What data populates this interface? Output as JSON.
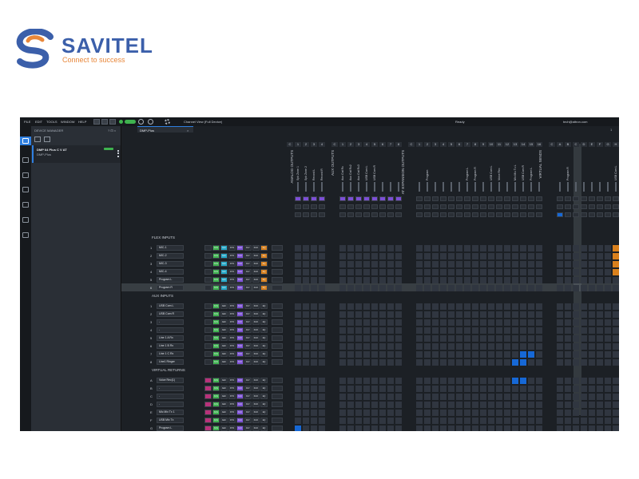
{
  "logo": {
    "word": "SAVITEL",
    "tagline": "Connect to success",
    "colors": {
      "primary": "#3b5faa",
      "accent": "#e8873a"
    }
  },
  "menubar": {
    "items": [
      "FILE",
      "EDIT",
      "TOOLS",
      "WINDOW",
      "HELP"
    ],
    "channel_view": "Channel View (Full Device)",
    "status": "Ready",
    "email": "tech@attron.com"
  },
  "device_manager": {
    "title": "DEVICE MANAGER",
    "controls": "? ⊡ ×",
    "device": {
      "name": "DMP 64 Plus C V AT",
      "sub": "DMP-Plus"
    }
  },
  "tab": {
    "label": "DMP-Plus",
    "close": "×",
    "number": "1"
  },
  "sections": {
    "flex": "FLEX INPUTS",
    "aux": "AUX INPUTS",
    "virtual": "VIRTUAL RETURNS"
  },
  "column_groups": {
    "analog": "ANALOG OUTPUTS",
    "aux": "AUX OUTPUTS",
    "expansion": "AT EXPANSION OUTPUTS",
    "vsends": "VIRTUAL SENDS"
  },
  "column_numbers": [
    "C",
    "1",
    "2",
    "3",
    "4",
    "C",
    "1",
    "2",
    "3",
    "4",
    "5",
    "6",
    "7",
    "8",
    "C",
    "1",
    "2",
    "3",
    "4",
    "5",
    "6",
    "7",
    "8",
    "9",
    "10",
    "11",
    "12",
    "13",
    "14",
    "15",
    "16",
    "C",
    "A",
    "B",
    "C",
    "D",
    "E",
    "F",
    "G",
    "H",
    "I",
    "J",
    "K"
  ],
  "column_labels": [
    "Spk Zone 1",
    "Spk Zone 2",
    "Record L",
    "Record R",
    "Aux Out Rx",
    "Aux Out Rx2",
    "Aux Out Rx3",
    "USB Com L",
    "USB Com R",
    "Program",
    "Program L",
    "Program R",
    "USB Com L",
    "Voice Rec",
    "Mic Mix Tx L",
    "USB Com R",
    "Program L",
    "Program R",
    "USB Com L"
  ],
  "flex_rows": [
    {
      "idx": "1",
      "name": "MIC-1"
    },
    {
      "idx": "2",
      "name": "MIC-2"
    },
    {
      "idx": "3",
      "name": "MIC-3"
    },
    {
      "idx": "4",
      "name": "MIC-4"
    },
    {
      "idx": "5",
      "name": "Program L"
    },
    {
      "idx": "6",
      "name": "Program R"
    }
  ],
  "aux_rows": [
    {
      "idx": "1",
      "name": "USB Com L"
    },
    {
      "idx": "2",
      "name": "USB Com R"
    },
    {
      "idx": "3",
      "name": "-"
    },
    {
      "idx": "4",
      "name": "-"
    },
    {
      "idx": "5",
      "name": "Line 1 A Rx"
    },
    {
      "idx": "6",
      "name": "Line 1 B Rx"
    },
    {
      "idx": "7",
      "name": "Line 1 C Rx"
    },
    {
      "idx": "8",
      "name": "Line1 Ringer"
    }
  ],
  "virtual_rows": [
    {
      "idx": "A",
      "name": "Voice Rec(1)"
    },
    {
      "idx": "B",
      "name": "-"
    },
    {
      "idx": "C",
      "name": "-"
    },
    {
      "idx": "D",
      "name": "-"
    },
    {
      "idx": "E",
      "name": "Mic Mix Tx 1"
    },
    {
      "idx": "F",
      "name": "USB Mix Tx"
    },
    {
      "idx": "G",
      "name": "Program L"
    }
  ],
  "chips": [
    "ANG",
    "AEC",
    "DYN",
    "AGC",
    "DLY",
    "DUC",
    "EQ"
  ],
  "colors": {
    "accent": "#2f7fe0",
    "route_blue": "#1668d6",
    "route_orange": "#d9801c",
    "green": "#3fb34f",
    "purple": "#7c4fd6",
    "cyan": "#22a8c8"
  }
}
